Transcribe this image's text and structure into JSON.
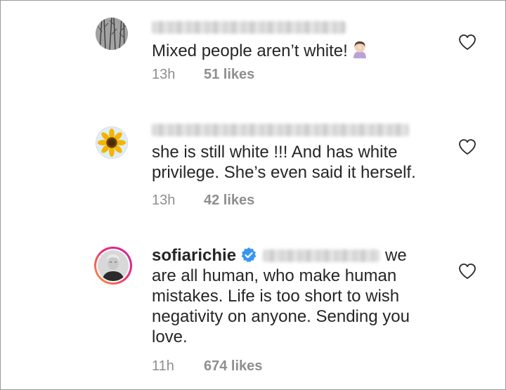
{
  "comments": [
    {
      "username": "",
      "text": "Mixed people aren’t white!",
      "emoji": "woman-facepalming",
      "time": "13h",
      "likes": "51 likes",
      "avatar": "bare-trees-photo"
    },
    {
      "username": "",
      "text_lines": [
        "she is still white !!! And has white",
        "privilege. She’s even said it herself."
      ],
      "time": "13h",
      "likes": "42 likes",
      "avatar": "sunflower-photo"
    },
    {
      "username": "sofiarichie",
      "verified": true,
      "mention_suffix": "we",
      "text_lines": [
        "are all human, who make human",
        "mistakes. Life is too short to wish",
        "negativity on anyone. Sending you",
        "love."
      ],
      "time": "11h",
      "likes": "674 likes",
      "avatar": "portrait-photo-with-story-ring"
    }
  ],
  "colors": {
    "text": "#262626",
    "meta": "#8e8e8e",
    "verified_badge": "#3897f0",
    "story_ring_start": "#f9a43b",
    "story_ring_end": "#c32aa3"
  },
  "icons": {
    "like": "heart-outline-icon",
    "verified": "verified-badge-icon"
  }
}
